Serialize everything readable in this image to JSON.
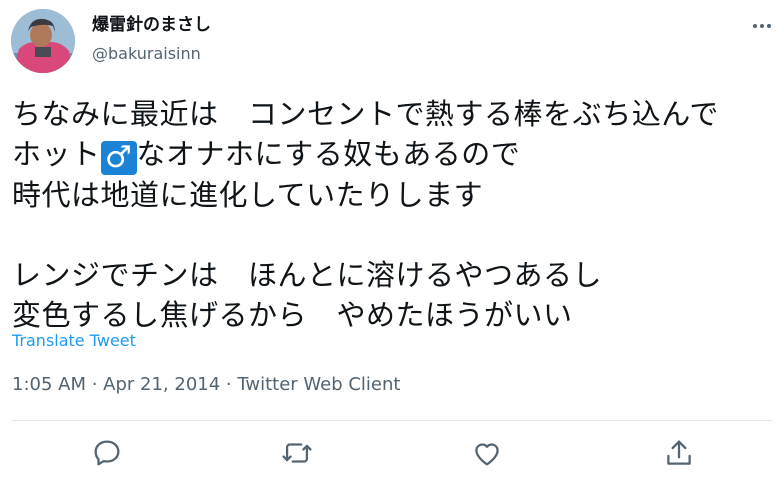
{
  "user": {
    "display_name": "爆雷針のまさし",
    "handle": "@bakuraisinn"
  },
  "tweet": {
    "line1": "ちなみに最近は　コンセントで熱する棒をぶち込んで",
    "line2_pre": "ホット",
    "line2_emoji": "♂",
    "line2_post": "なオナホにする奴もあるので",
    "line3": "時代は地道に進化していたりします",
    "line4": "レンジでチンは　ほんとに溶けるやつあるし",
    "line5": "変色するし焦げるから　やめたほうがいい"
  },
  "translate_label": "Translate Tweet",
  "meta": "1:05 AM · Apr 21, 2014 · Twitter Web Client",
  "actions": {
    "reply_icon": "reply-icon",
    "retweet_icon": "retweet-icon",
    "like_icon": "like-icon",
    "share_icon": "share-icon"
  },
  "colors": {
    "link": "#1d9bf0",
    "secondary": "#536471",
    "text": "#0f1419"
  }
}
